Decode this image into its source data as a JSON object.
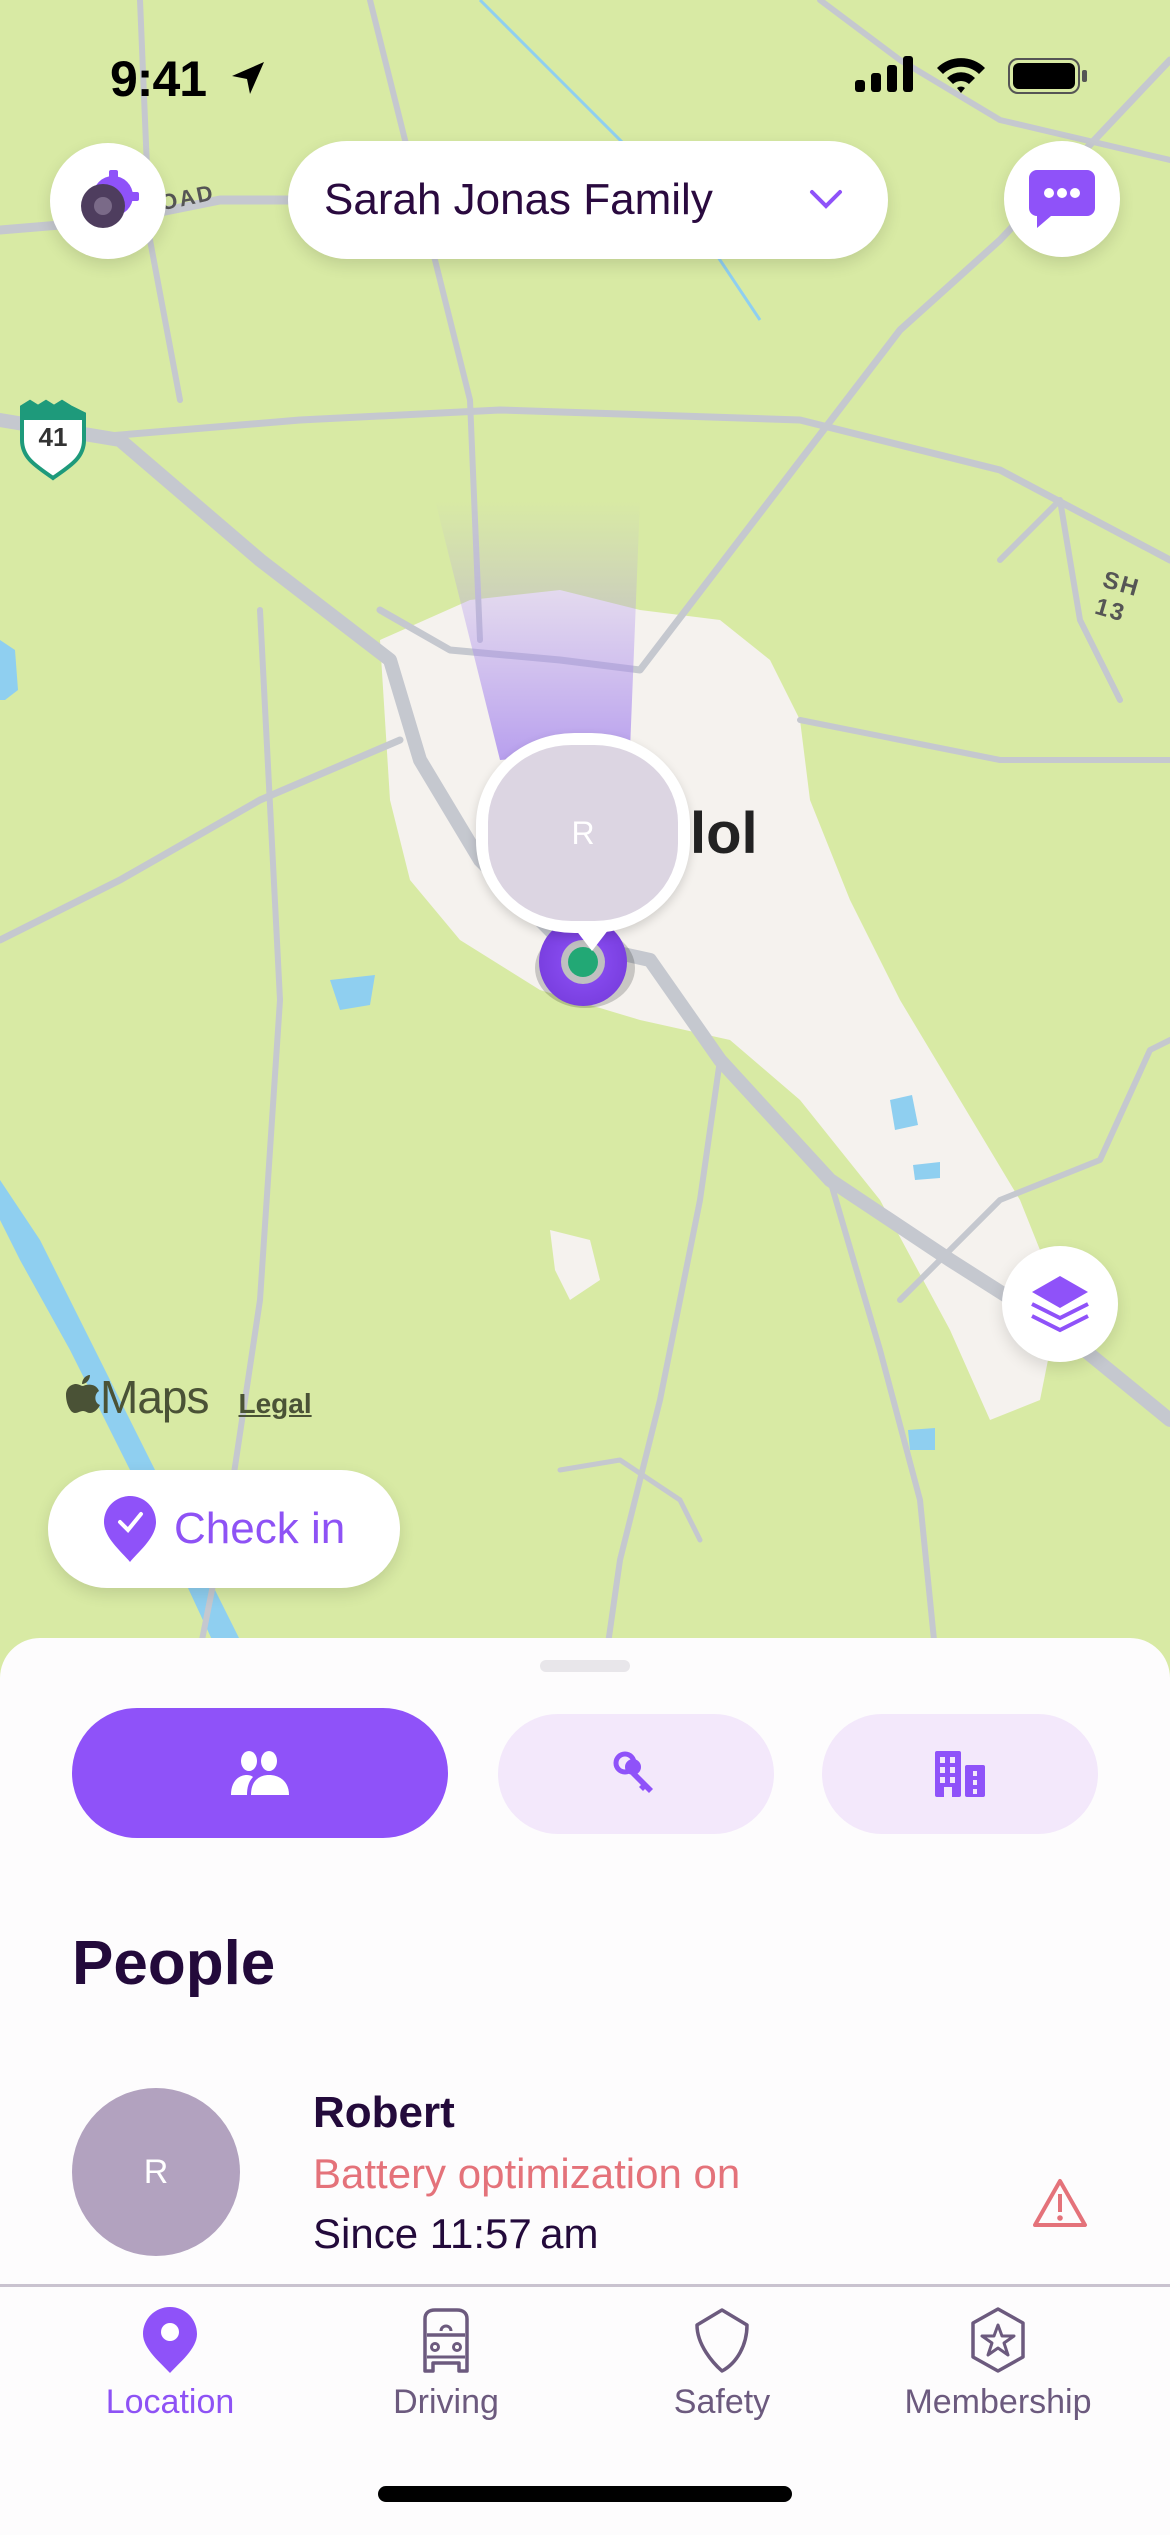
{
  "status_bar": {
    "time": "9:41",
    "icons": [
      "location-arrow-icon",
      "cellular-signal-icon",
      "wifi-icon",
      "battery-icon"
    ]
  },
  "header": {
    "settings_icon": "gear-icon",
    "circle_name": "Sarah Jonas Family",
    "dropdown_icon": "chevron-down-icon",
    "messages_icon": "chat-bubble-icon"
  },
  "map": {
    "road_labels": [
      "OAD",
      "SH 13"
    ],
    "highway_shield": "41",
    "city_label": "lol",
    "member_pin_initial": "R",
    "attribution": "Maps",
    "legal_link": "Legal",
    "layers_icon": "layers-icon"
  },
  "check_in": {
    "label": "Check in",
    "icon": "checkin-pin-icon"
  },
  "sheet": {
    "segments": [
      {
        "name": "people",
        "icon": "people-icon",
        "active": true
      },
      {
        "name": "items",
        "icon": "keys-icon",
        "active": false
      },
      {
        "name": "places",
        "icon": "buildings-icon",
        "active": false
      }
    ],
    "section_title": "People",
    "people": [
      {
        "initial": "R",
        "name": "Robert",
        "status": "Battery optimization on",
        "since": "Since 11:57 am",
        "alert_icon": "warning-icon"
      }
    ]
  },
  "tab_bar": {
    "tabs": [
      {
        "label": "Location",
        "icon": "location-pin-icon",
        "active": true
      },
      {
        "label": "Driving",
        "icon": "car-icon",
        "active": false
      },
      {
        "label": "Safety",
        "icon": "shield-icon",
        "active": false
      },
      {
        "label": "Membership",
        "icon": "star-badge-icon",
        "active": false
      }
    ]
  },
  "colors": {
    "accent": "#8f52f9",
    "accent_light": "#f3e8fb",
    "text_dark": "#230a3b",
    "alert": "#e4727a",
    "map_land": "#d8eaa4",
    "map_urban": "#f5f2ee"
  }
}
